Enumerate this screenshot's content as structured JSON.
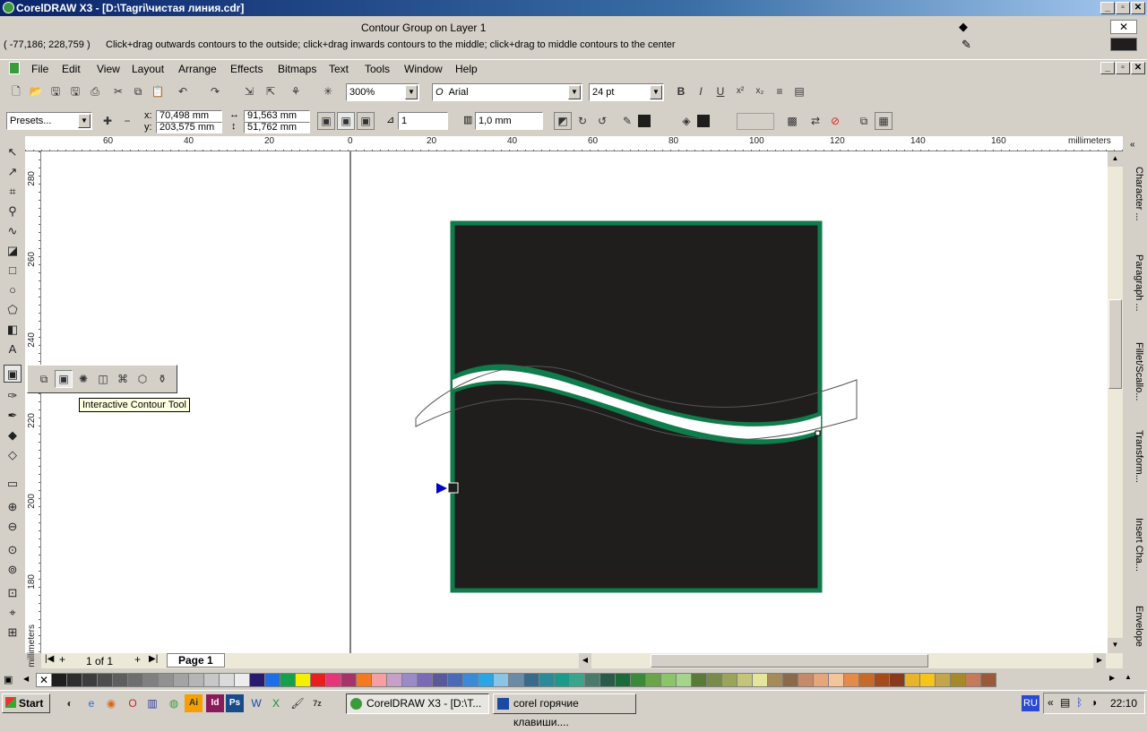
{
  "window": {
    "title": "CorelDRAW X3 - [D:\\Tagri\\чистая линия.cdr]",
    "min": "_",
    "max": "▫",
    "close": "✕"
  },
  "status": {
    "object": "Contour Group on Layer 1",
    "coords": "( -77,186; 228,759 )",
    "hint": "Click+drag outwards contours to the outside; click+drag inwards contours to the middle; click+drag to middle contours to the center"
  },
  "menu": [
    "File",
    "Edit",
    "View",
    "Layout",
    "Arrange",
    "Effects",
    "Bitmaps",
    "Text",
    "Tools",
    "Window",
    "Help"
  ],
  "toolbar": {
    "zoom": "300%",
    "font": "Arial",
    "size": "24 pt"
  },
  "props": {
    "presets": "Presets...",
    "x": "70,498 mm",
    "y": "203,575 mm",
    "w": "91,563 mm",
    "h": "51,762 mm",
    "steps": "1",
    "offset": "1,0 mm",
    "x_lbl": "x:",
    "y_lbl": "y:"
  },
  "ruler": {
    "unit": "millimeters",
    "top": [
      "60",
      "40",
      "20",
      "0",
      "20",
      "40",
      "60",
      "80",
      "100",
      "120",
      "140",
      "160"
    ],
    "left": [
      "280",
      "260",
      "240",
      "220",
      "200",
      "180"
    ]
  },
  "tooltip": "Interactive Contour Tool",
  "dockers": [
    "Character ...",
    "Paragraph ...",
    "Fillet/Scallo...",
    "Transform...",
    "Insert Cha...",
    "Envelope"
  ],
  "pager": {
    "count": "1 of 1",
    "page": "Page 1"
  },
  "palette": [
    "#ffffff",
    "#1e1e1e",
    "#2e2e2e",
    "#3d3d3d",
    "#4d4d4d",
    "#5e5e5e",
    "#6e6e6e",
    "#808080",
    "#919191",
    "#a3a3a3",
    "#b5b5b5",
    "#c7c7c7",
    "#dadada",
    "#ededed",
    "#2a1a6e",
    "#1e6ee6",
    "#14a14a",
    "#f5f000",
    "#e62020",
    "#e6357a",
    "#a6336a",
    "#f57920",
    "#f5a0a0",
    "#c7a0c7",
    "#9a8ac7",
    "#7a6ab5",
    "#5a5a9a",
    "#4a6ab5",
    "#3a8ad5",
    "#2aa5e6",
    "#8ac5e6",
    "#6a8aa5",
    "#3a6a8a",
    "#2a8a9a",
    "#1a9a8a",
    "#3aa58a",
    "#4a7a6a",
    "#2a5a4a",
    "#1a6a3a",
    "#3a8a3a",
    "#6aa54a",
    "#8ac56a",
    "#a5d58a",
    "#5a7a3a",
    "#7a8a4a",
    "#9aa55a",
    "#c5c57a",
    "#e6e69a",
    "#a58a5a",
    "#8a6a4a",
    "#c58a6a",
    "#e6a57a",
    "#f5c59a",
    "#e68a4a",
    "#c56a2a",
    "#a54a1a",
    "#8a3a1a",
    "#e6b52a",
    "#f5c51a",
    "#c5a54a",
    "#a58a2a",
    "#c57a5a",
    "#9a5a3a"
  ],
  "taskbar": {
    "start": "Start",
    "tasks": [
      "CorelDRAW X3 - [D:\\T...",
      "corel горячие клавиши...."
    ],
    "lang": "RU",
    "time": "22:10"
  },
  "colors": {
    "rect_fill": "#1f1e1c",
    "rect_stroke": "#0f7c4c",
    "accent": "#0a246a"
  }
}
